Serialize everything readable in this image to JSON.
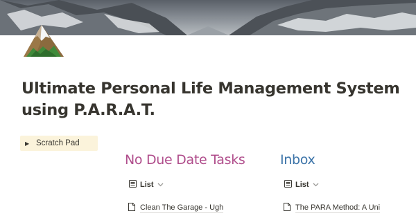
{
  "cover": {
    "description_colors": {
      "sky": "#b9bdc1",
      "rock": "#4a4f55",
      "snow": "#e6e8ea"
    }
  },
  "page": {
    "icon": "mountain-icon",
    "title": "Ultimate Personal Life Management System using P.A.R.A.T."
  },
  "scratch_pad": {
    "label": "Scratch Pad",
    "arrow_icon": "triangle-right-icon",
    "background": "#fbf3db"
  },
  "columns": [
    {
      "heading": "No Due Date Tasks",
      "heading_color": "#b04e8c",
      "view": {
        "icon": "list-view-icon",
        "label": "List",
        "dropdown_icon": "chevron-down-icon"
      },
      "items": [
        {
          "icon": "page-icon",
          "title": "Clean The Garage - Ugh"
        }
      ]
    },
    {
      "heading": "Inbox",
      "heading_color": "#3b73a8",
      "view": {
        "icon": "list-view-icon",
        "label": "List",
        "dropdown_icon": "chevron-down-icon"
      },
      "items": [
        {
          "icon": "page-icon",
          "title": "The PARA Method: A Uni"
        }
      ]
    }
  ]
}
